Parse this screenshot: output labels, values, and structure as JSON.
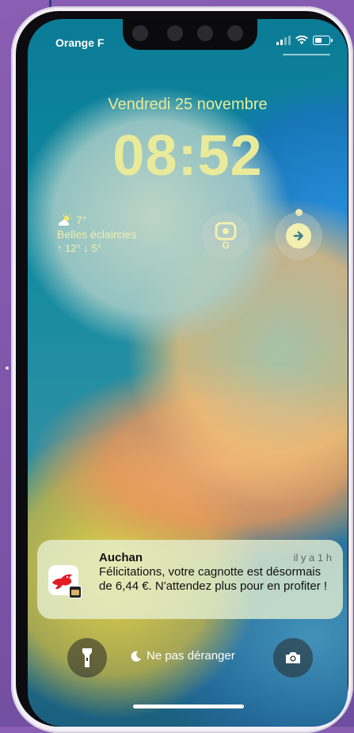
{
  "status_bar": {
    "carrier": "Orange F",
    "signal_icon": "cellular-signal-icon",
    "wifi_icon": "wifi-icon",
    "battery_icon": "battery-icon"
  },
  "lock_screen": {
    "date": "Vendredi 25 novembre",
    "time": "08:52",
    "accent_color": "#e9eb9a"
  },
  "widgets": {
    "weather": {
      "temperature": "7°",
      "condition": "Belles éclaircies",
      "high_low": "↑ 12° ↓ 5°",
      "icon": "partly-sunny-icon"
    },
    "google_lens": {
      "icon": "google-lens-icon",
      "label": "G"
    },
    "navigation": {
      "icon": "navigation-arrow-icon"
    }
  },
  "notification": {
    "app": "Auchan",
    "time": "il y a 1 h",
    "body": "Félicitations, votre cagnotte est désormais de 6,44 €. N'attendez plus pour en profiter !",
    "icon": "auchan-bird-icon",
    "badge_icon": "wallet-icon"
  },
  "bottom_bar": {
    "flashlight_icon": "flashlight-icon",
    "focus_icon": "moon-icon",
    "focus_label": "Ne pas déranger",
    "camera_icon": "camera-icon"
  }
}
